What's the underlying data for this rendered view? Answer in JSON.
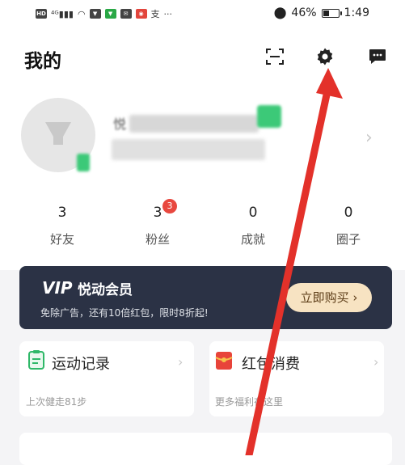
{
  "status_bar": {
    "left_icons": [
      "HD",
      "4G",
      "signal",
      "wifi"
    ],
    "battery": "46%",
    "time": "1:49",
    "battery_level": 0.46
  },
  "header": {
    "title": "我的"
  },
  "profile": {
    "name_partial": "悦",
    "chevron": "›"
  },
  "stats": [
    {
      "value": "3",
      "label": "好友"
    },
    {
      "value": "3",
      "label": "粉丝",
      "badge": "3"
    },
    {
      "value": "0",
      "label": "成就"
    },
    {
      "value": "0",
      "label": "圈子"
    }
  ],
  "vip": {
    "logo": "VIP",
    "title": "悦动会员",
    "desc": "免除广告，还有10倍红包，限时8折起!",
    "button": "立即购买 ›"
  },
  "cards": [
    {
      "title": "运动记录",
      "subtitle": "上次健走81步"
    },
    {
      "title": "红包消费",
      "subtitle": "更多福利在这里"
    }
  ],
  "bottom_partial": "",
  "colors": {
    "vip_bg": "#2b3245",
    "vip_button": "#f7e3c2",
    "badge": "#e8483f",
    "arrow": "#e3312a",
    "accent_green": "#3cc978"
  }
}
